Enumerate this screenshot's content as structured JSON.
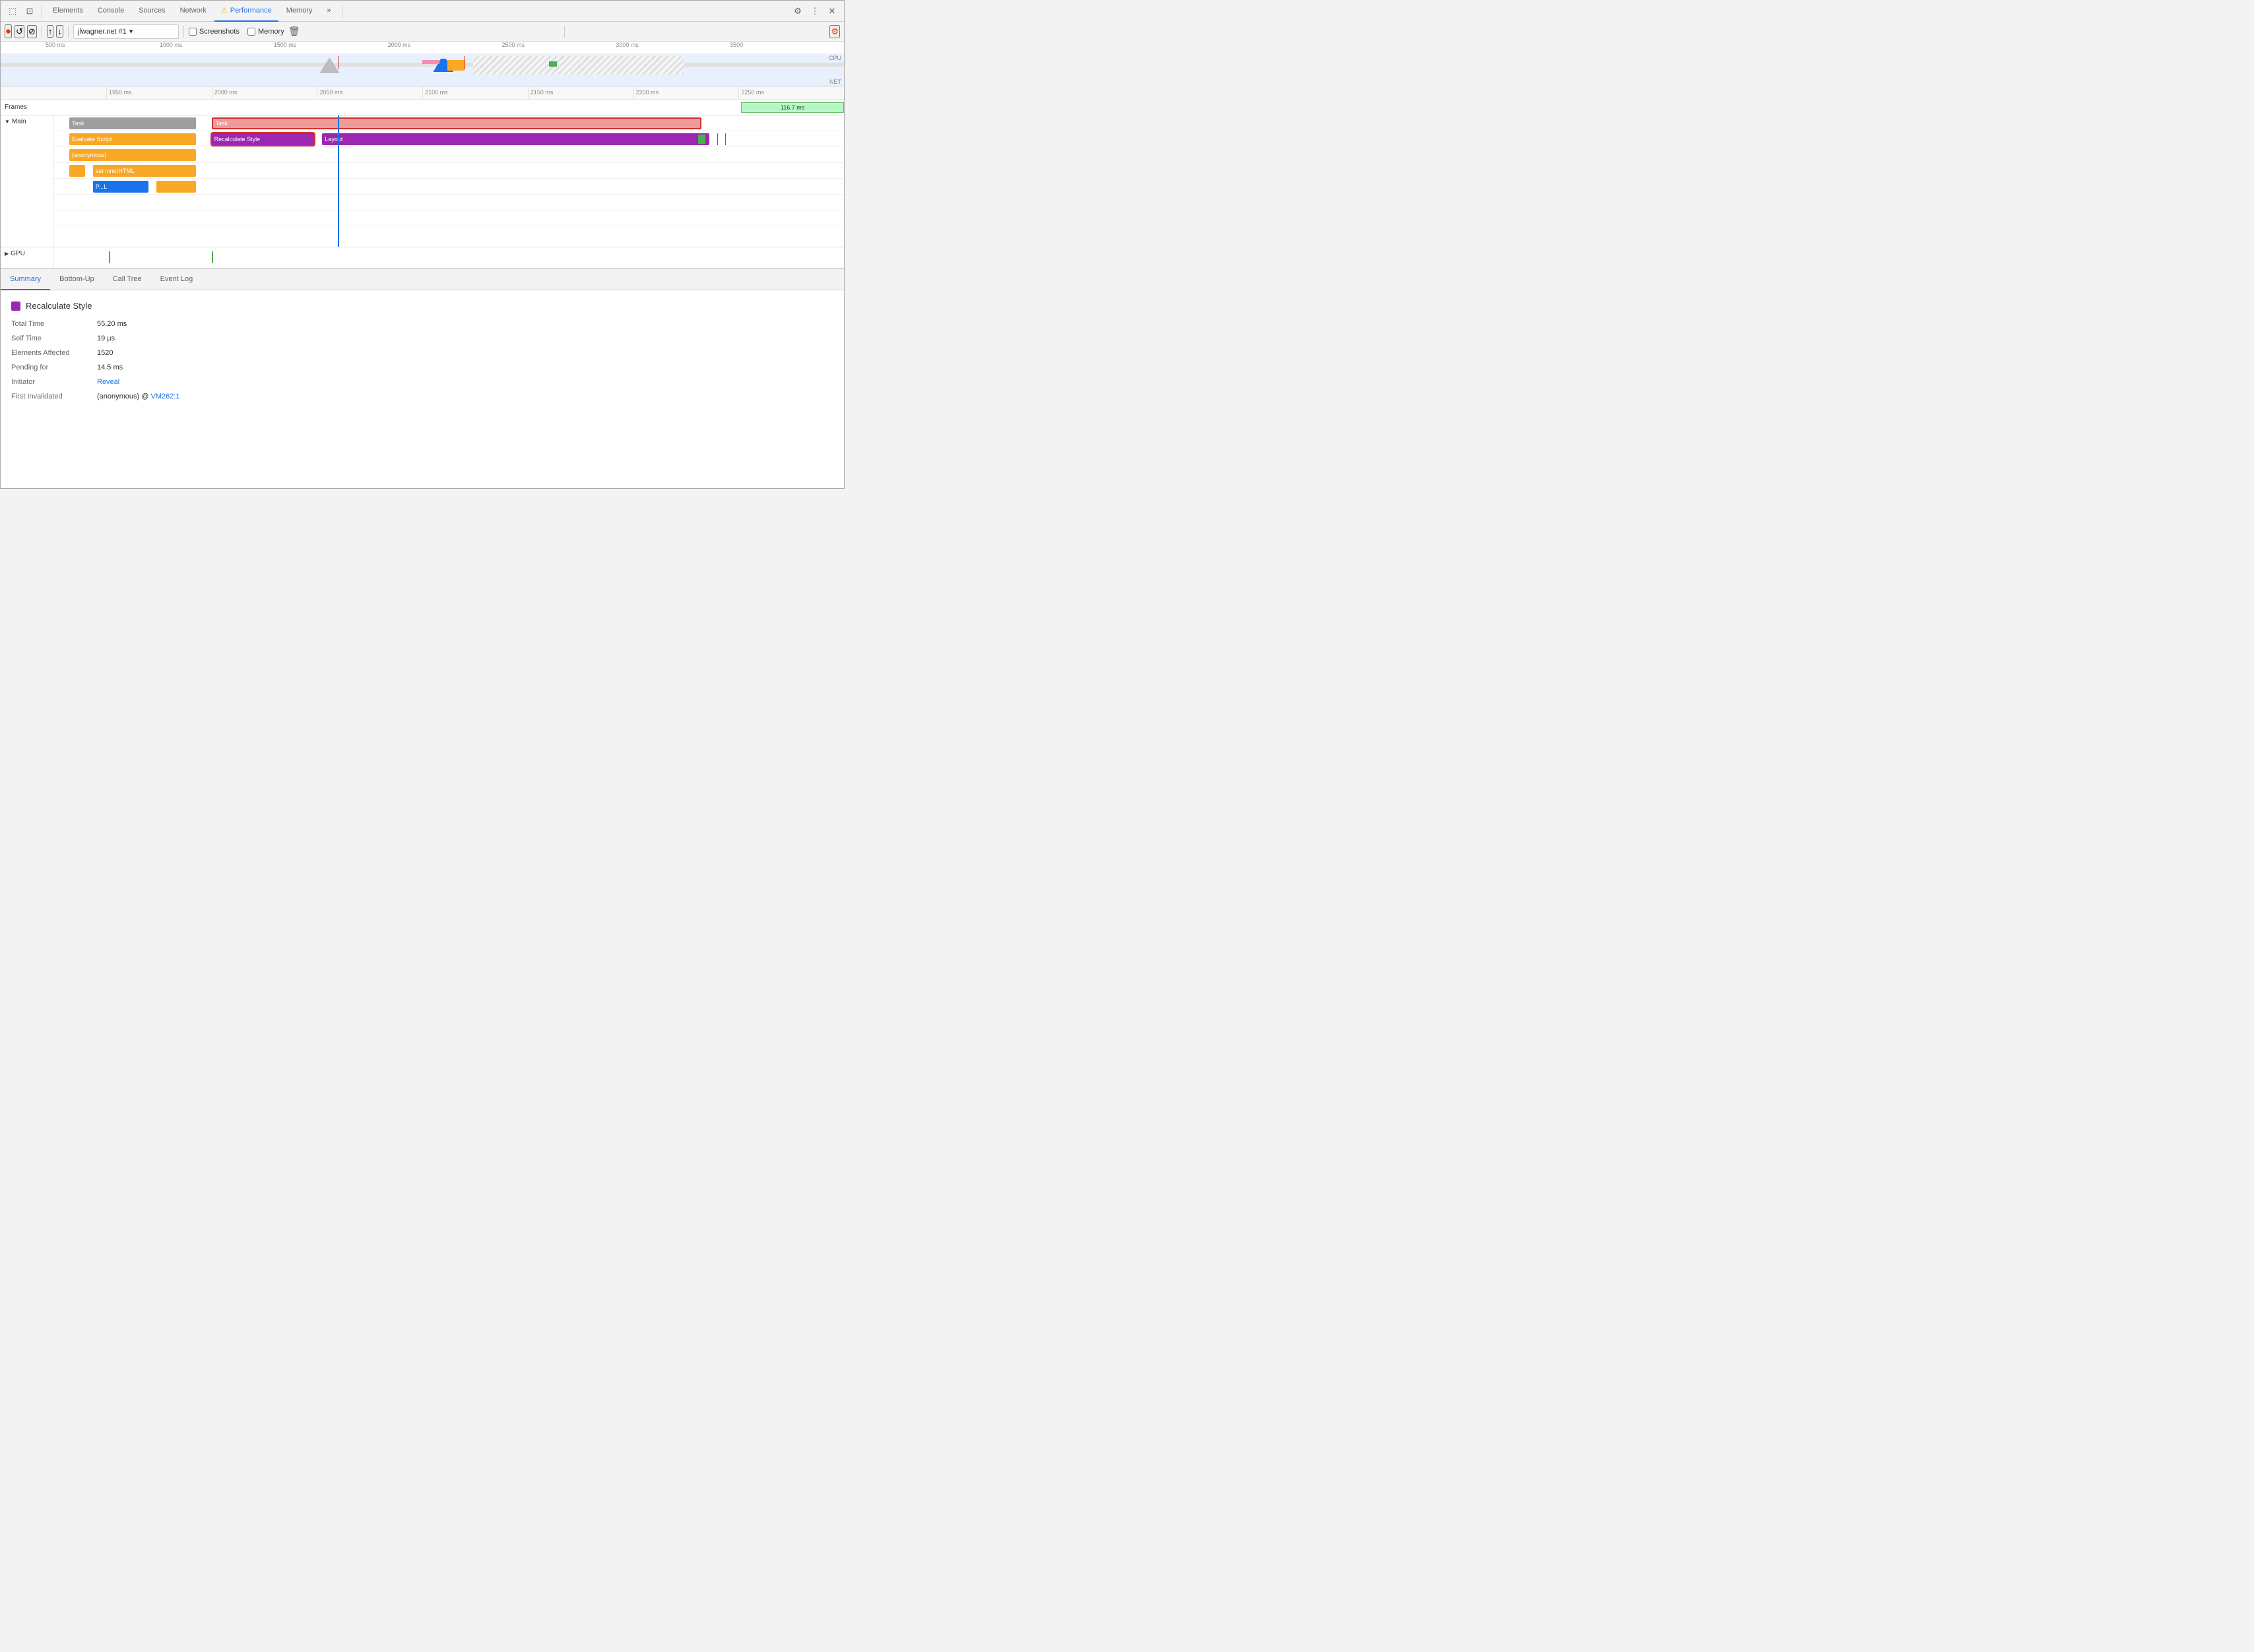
{
  "devtools": {
    "title": "Chrome DevTools"
  },
  "toolbar_top": {
    "tabs": [
      {
        "id": "elements",
        "label": "Elements",
        "active": false
      },
      {
        "id": "console",
        "label": "Console",
        "active": false
      },
      {
        "id": "sources",
        "label": "Sources",
        "active": false
      },
      {
        "id": "network",
        "label": "Network",
        "active": false
      },
      {
        "id": "performance",
        "label": "Performance",
        "active": true,
        "warn": true
      },
      {
        "id": "memory",
        "label": "Memory",
        "active": false
      }
    ],
    "more_label": "»",
    "settings_label": "⚙",
    "more_vert_label": "⋮",
    "close_label": "✕"
  },
  "toolbar_perf": {
    "record_label": "⏺",
    "reload_label": "↺",
    "clear_label": "⊘",
    "upload_label": "↑",
    "download_label": "↓",
    "url": "jlwagner.net #1",
    "screenshots_label": "Screenshots",
    "memory_label": "Memory",
    "trash_label": "🗑",
    "gear_red_label": "⚙"
  },
  "overview": {
    "ruler_ticks": [
      "500 ms",
      "1000 ms",
      "1500 ms",
      "2000 ms",
      "2500 ms",
      "3000 ms",
      "3500"
    ],
    "cpu_label": "CPU",
    "net_label": "NET"
  },
  "detail_timeline": {
    "ruler_labels": [
      "1950 ms",
      "2000 ms",
      "2050 ms",
      "2100 ms",
      "2150 ms",
      "2200 ms",
      "2250 ms"
    ],
    "frames_label": "Frames",
    "frame_block_text": "116.7 ms",
    "main_label": "▼ Main",
    "gpu_label": "▶ GPU",
    "tracks": [
      {
        "row": 0,
        "blocks": [
          {
            "label": "Task",
            "color": "#9e9e9e",
            "left_pct": 2,
            "width_pct": 16,
            "hatched": false,
            "outlined": false
          },
          {
            "label": "Task",
            "color": "#9e9e9e",
            "left_pct": 20,
            "width_pct": 62,
            "hatched": true,
            "outlined": true
          }
        ]
      },
      {
        "row": 1,
        "blocks": [
          {
            "label": "Evaluate Script",
            "color": "#f9a825",
            "left_pct": 2,
            "width_pct": 16,
            "hatched": false,
            "outlined": false
          },
          {
            "label": "Recalculate Style",
            "color": "#9c27b0",
            "left_pct": 20,
            "width_pct": 14,
            "hatched": false,
            "outlined": true
          },
          {
            "label": "Layout",
            "color": "#9c27b0",
            "left_pct": 35,
            "width_pct": 47,
            "hatched": false,
            "outlined": false
          }
        ]
      },
      {
        "row": 2,
        "blocks": [
          {
            "label": "(anonymous)",
            "color": "#f9a825",
            "left_pct": 2,
            "width_pct": 16,
            "hatched": false,
            "outlined": false
          }
        ]
      },
      {
        "row": 3,
        "blocks": [
          {
            "label": "",
            "color": "#f9a825",
            "left_pct": 2,
            "width_pct": 2,
            "hatched": false,
            "outlined": false
          },
          {
            "label": "set innerHTML",
            "color": "#f9a825",
            "left_pct": 5,
            "width_pct": 13,
            "hatched": false,
            "outlined": false
          }
        ]
      },
      {
        "row": 4,
        "blocks": [
          {
            "label": "P...L",
            "color": "#1a73e8",
            "left_pct": 5,
            "width_pct": 8,
            "hatched": false,
            "outlined": false
          },
          {
            "label": "",
            "color": "#f9a825",
            "left_pct": 13,
            "width_pct": 5,
            "hatched": false,
            "outlined": false
          }
        ]
      }
    ]
  },
  "bottom_tabs": [
    {
      "id": "summary",
      "label": "Summary",
      "active": true
    },
    {
      "id": "bottom-up",
      "label": "Bottom-Up",
      "active": false
    },
    {
      "id": "call-tree",
      "label": "Call Tree",
      "active": false
    },
    {
      "id": "event-log",
      "label": "Event Log",
      "active": false
    }
  ],
  "summary": {
    "title": "Recalculate Style",
    "swatch_color": "#9c27b0",
    "rows": [
      {
        "key": "Total Time",
        "value": "55.20 ms"
      },
      {
        "key": "Self Time",
        "value": "19 μs"
      },
      {
        "key": "Elements Affected",
        "value": "1520"
      },
      {
        "key": "Pending for",
        "value": "14.5 ms"
      },
      {
        "key": "Initiator",
        "value": "",
        "link": "Reveal",
        "link_href": "#"
      },
      {
        "key": "First Invalidated",
        "value": "(anonymous) @ VM262:1",
        "link": "VM262:1",
        "pre_text": "(anonymous) @ "
      }
    ]
  }
}
